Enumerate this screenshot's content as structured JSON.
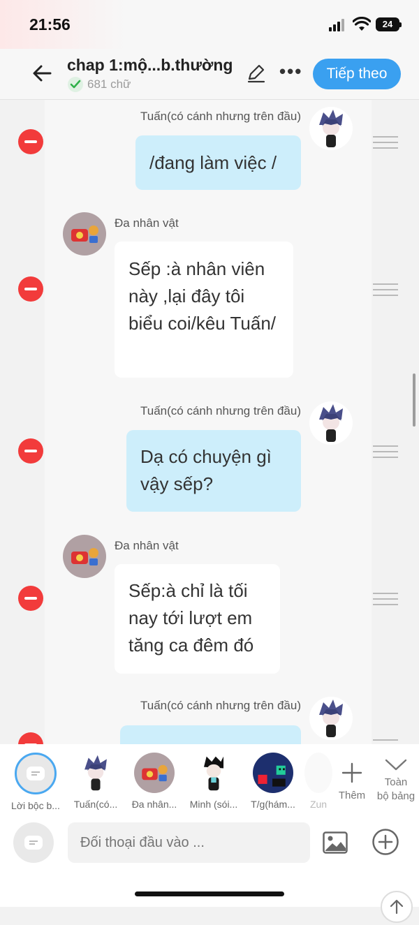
{
  "status_bar": {
    "time": "21:56",
    "battery": "24"
  },
  "header": {
    "title": "chap 1:mộ...b.thường",
    "word_count": "681 chữ",
    "next_label": "Tiếp theo"
  },
  "messages": [
    {
      "speaker": "Tuấn(có cánh nhưng trên đầu)",
      "side": "right",
      "text": "/đang làm việc /"
    },
    {
      "speaker": "Đa nhân vật",
      "side": "left",
      "text": "Sếp :à nhân viên này ,lại đây tôi biểu coi/kêu Tuấn/"
    },
    {
      "speaker": "Tuấn(có cánh nhưng trên đầu)",
      "side": "right",
      "text": "Dạ có chuyện gì vậy sếp?"
    },
    {
      "speaker": "Đa nhân vật",
      "side": "left",
      "text": "Sếp:à chỉ là tối nay tới lượt em tăng ca đêm đó"
    },
    {
      "speaker": "Tuấn(có cánh nhưng trên đầu)",
      "side": "right",
      "text": ""
    }
  ],
  "characters": [
    {
      "label": "Lời bộc b...",
      "selected": true
    },
    {
      "label": "Tuấn(có..."
    },
    {
      "label": "Đa nhân..."
    },
    {
      "label": "Minh (sói..."
    },
    {
      "label": "T/g(hám..."
    },
    {
      "label": "Zun"
    }
  ],
  "panel": {
    "add_label": "Thêm",
    "all_board_label_1": "Toàn",
    "all_board_label_2": "bộ bảng"
  },
  "input": {
    "placeholder": "Đối thoại đầu vào ..."
  },
  "colors": {
    "accent": "#3aa0f0",
    "minus": "#f23b3b",
    "bubble_blue": "#cdeefb"
  }
}
